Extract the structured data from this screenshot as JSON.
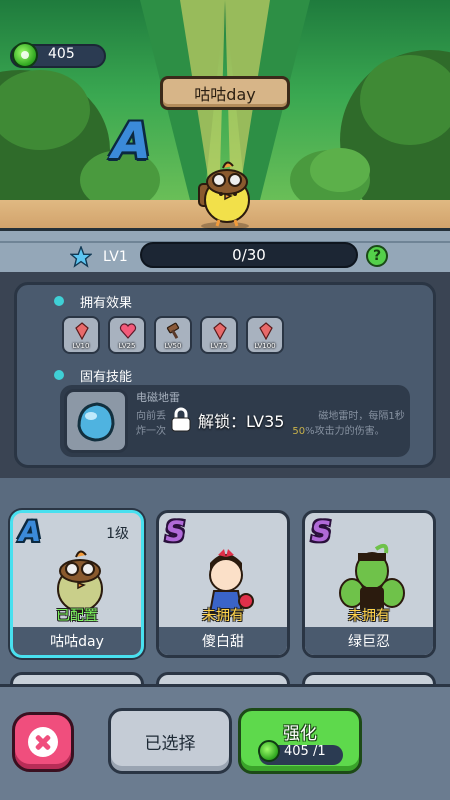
{
  "currency": {
    "amount": "405",
    "icon": "green-gem-icon"
  },
  "hero": {
    "name": "咕咕day",
    "rank": "A"
  },
  "level": {
    "label": "LV1",
    "xp_text": "0/30",
    "progress": 0.0,
    "help": "?"
  },
  "effects": {
    "title": "拥有效果",
    "items": [
      {
        "label": "LV10",
        "icon": "red-crystal-icon"
      },
      {
        "label": "LV25",
        "icon": "heart-icon"
      },
      {
        "label": "LV50",
        "icon": "hammer-icon"
      },
      {
        "label": "LV75",
        "icon": "red-crystal-icon"
      },
      {
        "label": "LV100",
        "icon": "red-crystal-icon"
      }
    ]
  },
  "skill": {
    "title": "固有技能",
    "name": "电磁地雷",
    "desc_1": "向前丢",
    "desc_2": "炸一次",
    "desc_mid": "磁地雷时，每隔1秒",
    "desc_pct": "50",
    "desc_end": "%攻击力的伤害。",
    "lock_text": "解锁：LV35"
  },
  "cards": [
    {
      "grade": "A",
      "level": "1级",
      "status": "已配置",
      "name": "咕咕day"
    },
    {
      "grade": "S",
      "level": "",
      "status": "未拥有",
      "name": "傻白甜"
    },
    {
      "grade": "S",
      "level": "",
      "status": "未拥有",
      "name": "绿巨忍"
    }
  ],
  "actions": {
    "selected_label": "已选择",
    "upgrade_label": "强化",
    "upgrade_cost": "405 /1"
  },
  "colors": {
    "accent": "#49e0ef",
    "upgrade": "#5ed94c",
    "close": "#f04e7d"
  }
}
